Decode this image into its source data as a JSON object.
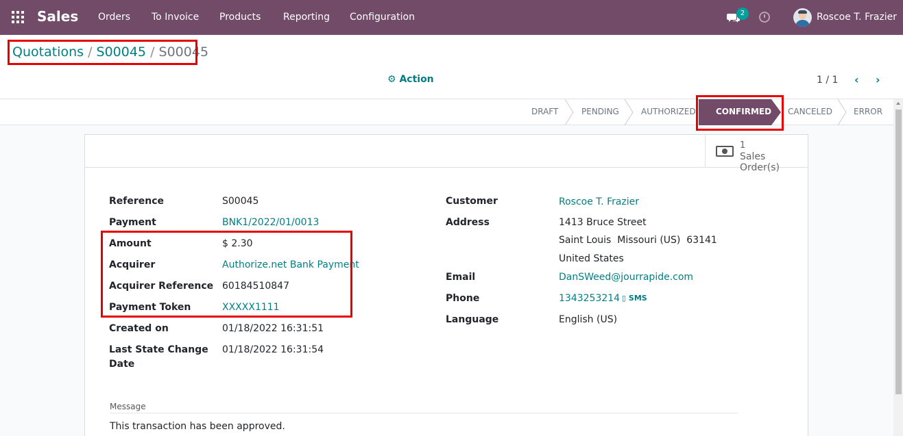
{
  "navbar": {
    "app_name": "Sales",
    "menu": [
      "Orders",
      "To Invoice",
      "Products",
      "Reporting",
      "Configuration"
    ],
    "chat_count": "2",
    "user_name": "Roscoe T. Frazier",
    "icons": [
      "apps-icon",
      "chat-icon",
      "clock-icon",
      "avatar"
    ]
  },
  "breadcrumb": {
    "items": [
      "Quotations",
      "S00045"
    ],
    "separator": "/",
    "current": "S00045"
  },
  "action": {
    "label": "Action",
    "icon": "gear-icon"
  },
  "pager": {
    "value": "1 / 1"
  },
  "statusbar": {
    "stages": [
      "DRAFT",
      "PENDING",
      "AUTHORIZED",
      "CONFIRMED",
      "CANCELED",
      "ERROR"
    ],
    "active": "CONFIRMED"
  },
  "smart_button": {
    "value": "1",
    "label": "Sales Order(s)",
    "icon": "money-icon"
  },
  "left_fields": [
    {
      "label": "Reference",
      "value": "S00045"
    },
    {
      "label": "Payment",
      "value": "BNK1/2022/01/0013"
    },
    {
      "label": "Amount",
      "value": "$ 2.30"
    },
    {
      "label": "Acquirer",
      "value": "Authorize.net Bank Payment"
    },
    {
      "label": "Acquirer Reference",
      "value": "60184510847"
    },
    {
      "label": "Payment Token",
      "value": "XXXXX1111"
    },
    {
      "label": "Created on",
      "value": "01/18/2022 16:31:51"
    },
    {
      "label_lines": [
        "Last State Change",
        "Date"
      ],
      "value": "01/18/2022 16:31:54"
    }
  ],
  "right_fields": {
    "customer": {
      "label": "Customer",
      "value": "Roscoe T. Frazier"
    },
    "address": {
      "label": "Address",
      "lines": [
        "1413 Bruce Street",
        "Saint Louis  Missouri (US)  63141",
        "United States"
      ]
    },
    "email": {
      "label": "Email",
      "value": "DanSWeed@jourrapide.com"
    },
    "phone": {
      "label": "Phone",
      "value": "1343253214",
      "sms": "SMS"
    },
    "language": {
      "label": "Language",
      "value": "English (US)"
    }
  },
  "message": {
    "label": "Message",
    "text": "This transaction has been approved."
  },
  "colors": {
    "brand": "#714b67",
    "link": "#017e84",
    "highlight": "#e60000",
    "badge": "#00a09d"
  }
}
